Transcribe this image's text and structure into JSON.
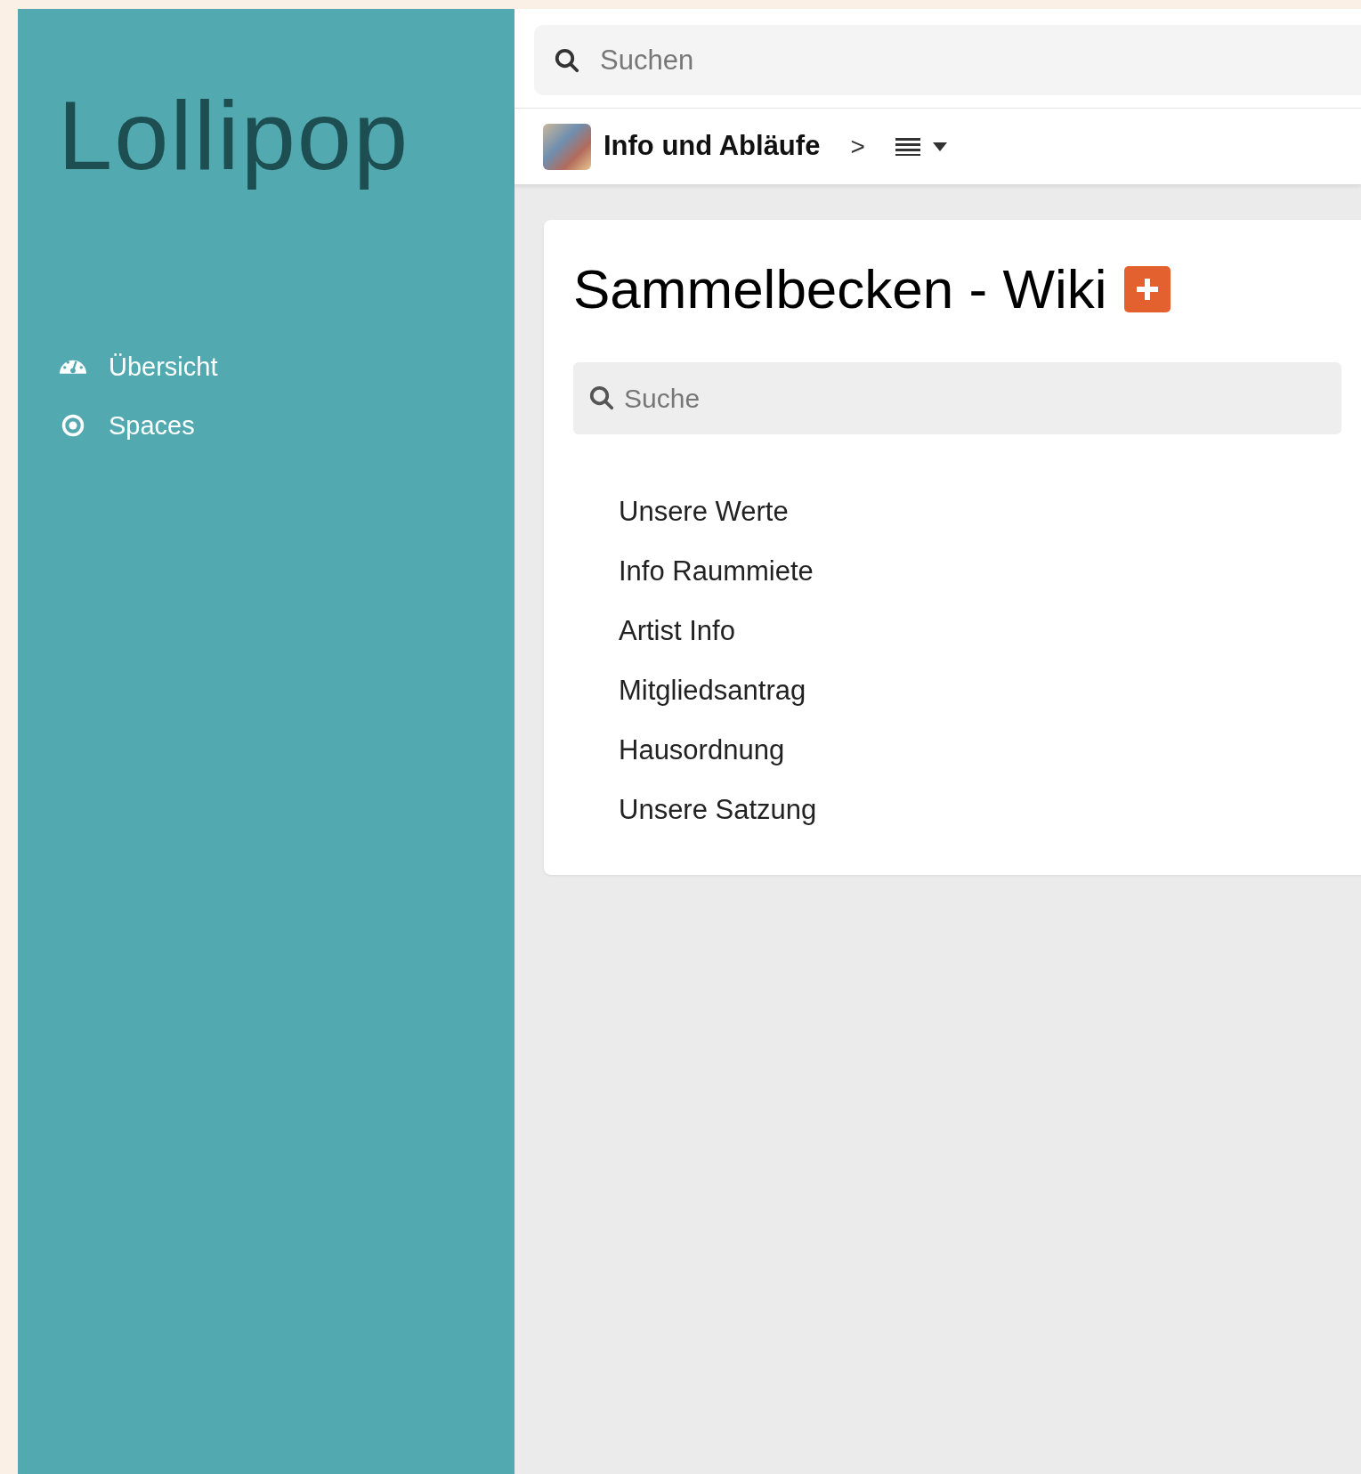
{
  "sidebar": {
    "logo": "Lollipop",
    "items": [
      {
        "kind": "dashboard",
        "label": "Übersicht"
      },
      {
        "kind": "spaces",
        "label": "Spaces"
      }
    ]
  },
  "top_search": {
    "placeholder": "Suchen"
  },
  "breadcrumb": {
    "space": "Info und Abläufe",
    "separator": ">"
  },
  "page": {
    "title": "Sammelbecken - Wiki",
    "search": {
      "placeholder": "Suche"
    },
    "links": [
      "Unsere Werte",
      "Info Raummiete",
      "Artist Info",
      "Mitgliedsantrag",
      "Hausordnung",
      "Unsere Satzung"
    ]
  }
}
